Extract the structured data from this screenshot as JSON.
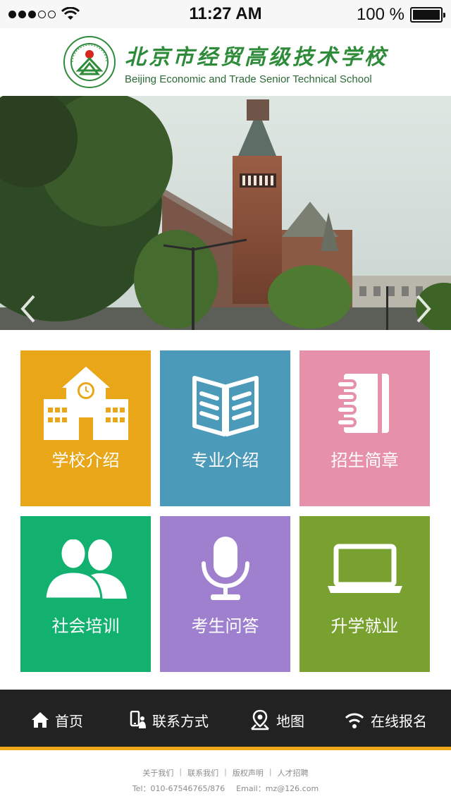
{
  "status_bar": {
    "time": "11:27 AM",
    "battery": "100 %",
    "signal_bars_filled": 3,
    "signal_bars_total": 5
  },
  "header": {
    "school_name_cn": "北京市经贸高级技术学校",
    "school_name_en": "Beijing Economic and Trade Senior Technical School",
    "logo_icon": "school-emblem-icon"
  },
  "banner": {
    "prev_icon": "chevron-left-icon",
    "next_icon": "chevron-right-icon"
  },
  "tiles": [
    {
      "label": "学校介绍",
      "icon": "school-building-icon",
      "color": "#e8a618"
    },
    {
      "label": "专业介绍",
      "icon": "open-book-icon",
      "color": "#4c9aba"
    },
    {
      "label": "招生简章",
      "icon": "notebook-icon",
      "color": "#e790aa"
    },
    {
      "label": "社会培训",
      "icon": "people-icon",
      "color": "#12b170"
    },
    {
      "label": "考生问答",
      "icon": "microphone-icon",
      "color": "#9e80cf"
    },
    {
      "label": "升学就业",
      "icon": "laptop-icon",
      "color": "#78a130"
    }
  ],
  "nav": [
    {
      "label": "首页",
      "icon": "home-icon"
    },
    {
      "label": "联系方式",
      "icon": "phone-contact-icon"
    },
    {
      "label": "地图",
      "icon": "map-pin-icon"
    },
    {
      "label": "在线报名",
      "icon": "wifi-icon"
    }
  ],
  "footer": {
    "links": [
      "关于我们",
      "联系我们",
      "版权声明",
      "人才招聘"
    ],
    "tel": "Tel：010-67546765/876",
    "email": "Email：mz@126.com"
  },
  "colors": {
    "nav_bg": "#222222",
    "nav_accent": "#f0a81a",
    "brand_green": "#2e8b3a"
  }
}
